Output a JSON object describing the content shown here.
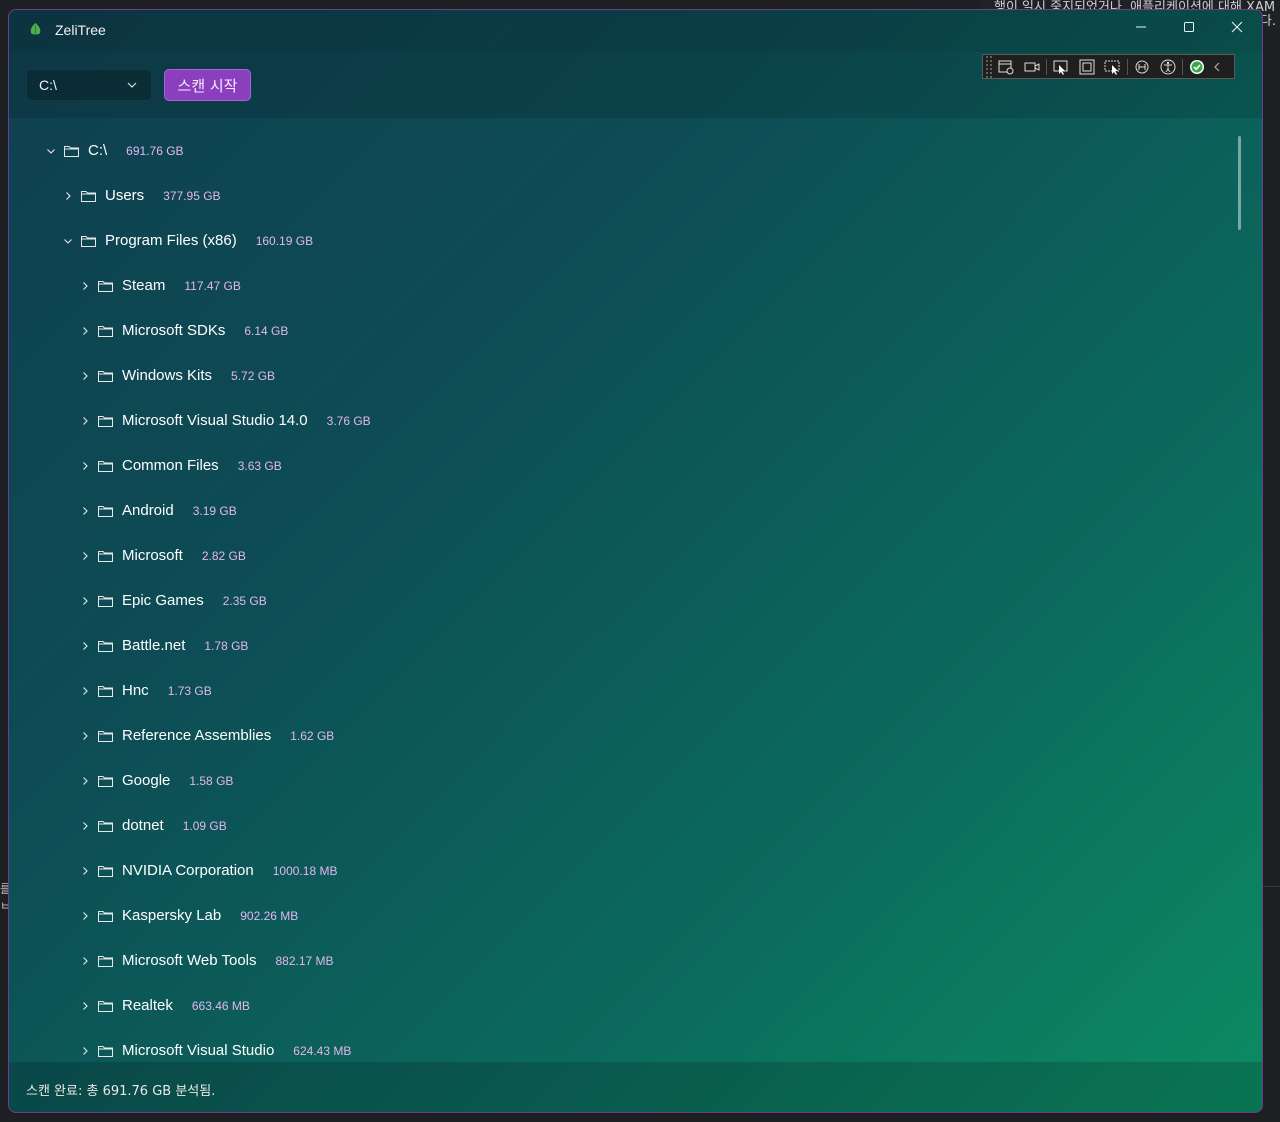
{
  "background": {
    "line1": "행이 일시 중지되었거나, 애플리케이션에 대해 XAM",
    "line2": "다.",
    "left_edge": "를 ㅂ:"
  },
  "window": {
    "title": "ZeliTree",
    "controls": [
      "minimize-icon",
      "maximize-icon",
      "close-icon"
    ]
  },
  "toolbar": {
    "drive_value": "C:\\",
    "scan_label": "스캔 시작"
  },
  "debug_toolbar": {
    "icons": [
      "live-visual-tree-icon",
      "record-icon",
      "select-element-icon",
      "display-layout-adorners-icon",
      "track-focus-icon",
      "hot-reload-icon",
      "accessibility-icon",
      "binding-check-icon",
      "collapse-icon"
    ]
  },
  "tree": [
    {
      "name": "C:\\",
      "size": "691.76 GB",
      "level": 0,
      "expanded": true
    },
    {
      "name": "Users",
      "size": "377.95 GB",
      "level": 1,
      "expanded": false
    },
    {
      "name": "Program Files (x86)",
      "size": "160.19 GB",
      "level": 1,
      "expanded": true
    },
    {
      "name": "Steam",
      "size": "117.47 GB",
      "level": 2,
      "expanded": false
    },
    {
      "name": "Microsoft SDKs",
      "size": "6.14 GB",
      "level": 2,
      "expanded": false
    },
    {
      "name": "Windows Kits",
      "size": "5.72 GB",
      "level": 2,
      "expanded": false
    },
    {
      "name": "Microsoft Visual Studio 14.0",
      "size": "3.76 GB",
      "level": 2,
      "expanded": false
    },
    {
      "name": "Common Files",
      "size": "3.63 GB",
      "level": 2,
      "expanded": false
    },
    {
      "name": "Android",
      "size": "3.19 GB",
      "level": 2,
      "expanded": false
    },
    {
      "name": "Microsoft",
      "size": "2.82 GB",
      "level": 2,
      "expanded": false
    },
    {
      "name": "Epic Games",
      "size": "2.35 GB",
      "level": 2,
      "expanded": false
    },
    {
      "name": "Battle.net",
      "size": "1.78 GB",
      "level": 2,
      "expanded": false
    },
    {
      "name": "Hnc",
      "size": "1.73 GB",
      "level": 2,
      "expanded": false
    },
    {
      "name": "Reference Assemblies",
      "size": "1.62 GB",
      "level": 2,
      "expanded": false
    },
    {
      "name": "Google",
      "size": "1.58 GB",
      "level": 2,
      "expanded": false
    },
    {
      "name": "dotnet",
      "size": "1.09 GB",
      "level": 2,
      "expanded": false
    },
    {
      "name": "NVIDIA Corporation",
      "size": "1000.18 MB",
      "level": 2,
      "expanded": false
    },
    {
      "name": "Kaspersky Lab",
      "size": "902.26 MB",
      "level": 2,
      "expanded": false
    },
    {
      "name": "Microsoft Web Tools",
      "size": "882.17 MB",
      "level": 2,
      "expanded": false
    },
    {
      "name": "Realtek",
      "size": "663.46 MB",
      "level": 2,
      "expanded": false
    },
    {
      "name": "Microsoft Visual Studio",
      "size": "624.43 MB",
      "level": 2,
      "expanded": false
    }
  ],
  "status": {
    "text": "스캔 완료: 총 691.76 GB 분석됨."
  },
  "colors": {
    "accent": "#8b3fbf",
    "size_text": "#e3b6ee",
    "window_border": "#6b3f8f"
  }
}
